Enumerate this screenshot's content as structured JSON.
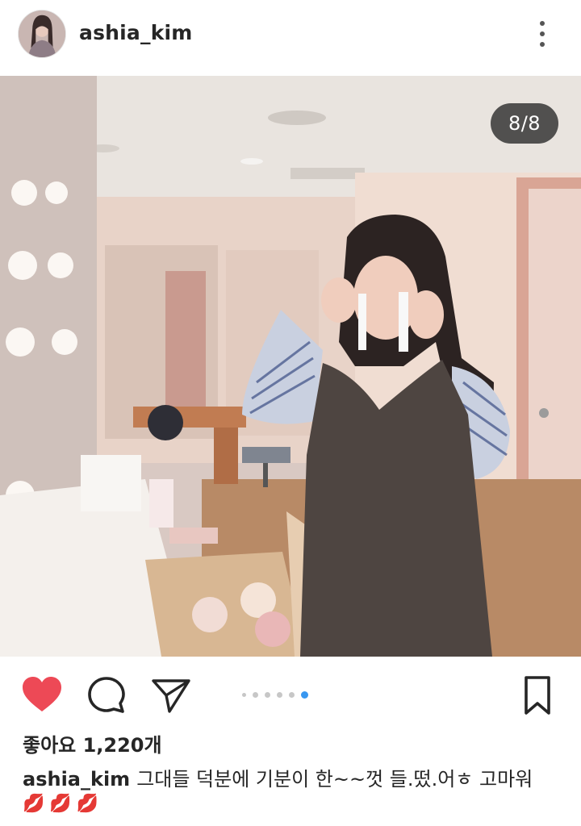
{
  "post": {
    "username": "ashia_kim",
    "counter": "8/8",
    "likes": "좋아요 1,220개",
    "caption_user": "ashia_kim",
    "caption_text": "그대들 덕분에 기분이 한~~껏 들.떴.어ㅎ 고마워",
    "caption_emoji": "💋💋💋"
  },
  "carousel": {
    "total": 6,
    "active_index": 5
  },
  "icons": {
    "like": "heart-icon",
    "comment": "comment-icon",
    "share": "send-icon",
    "bookmark": "bookmark-icon",
    "more": "more-vertical-icon"
  },
  "colors": {
    "like_red": "#ed4956",
    "active_dot": "#3897f0",
    "text": "#262626"
  }
}
